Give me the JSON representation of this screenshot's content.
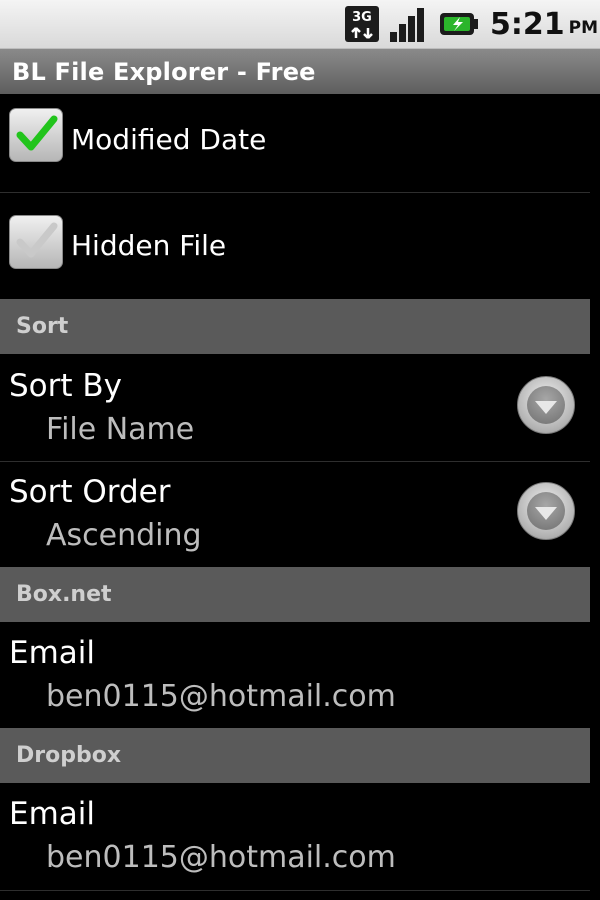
{
  "status_bar": {
    "network_type": "3G",
    "time": "5:21",
    "ampm": "PM"
  },
  "app": {
    "title": "BL File Explorer - Free"
  },
  "checkboxes": [
    {
      "label": "Modified Date",
      "checked": true
    },
    {
      "label": "Hidden File",
      "checked": false
    }
  ],
  "sections": {
    "sort": {
      "header": "Sort",
      "sort_by": {
        "title": "Sort By",
        "value": "File Name"
      },
      "sort_order": {
        "title": "Sort Order",
        "value": "Ascending"
      }
    },
    "box": {
      "header": "Box.net",
      "email": {
        "title": "Email",
        "value": "ben0115@hotmail.com"
      }
    },
    "dropbox": {
      "header": "Dropbox",
      "email": {
        "title": "Email",
        "value": "ben0115@hotmail.com"
      }
    }
  },
  "colors": {
    "check_green": "#22c41c",
    "section_header_bg": "#5a5a5a",
    "summary_text": "#bdbdbd"
  }
}
